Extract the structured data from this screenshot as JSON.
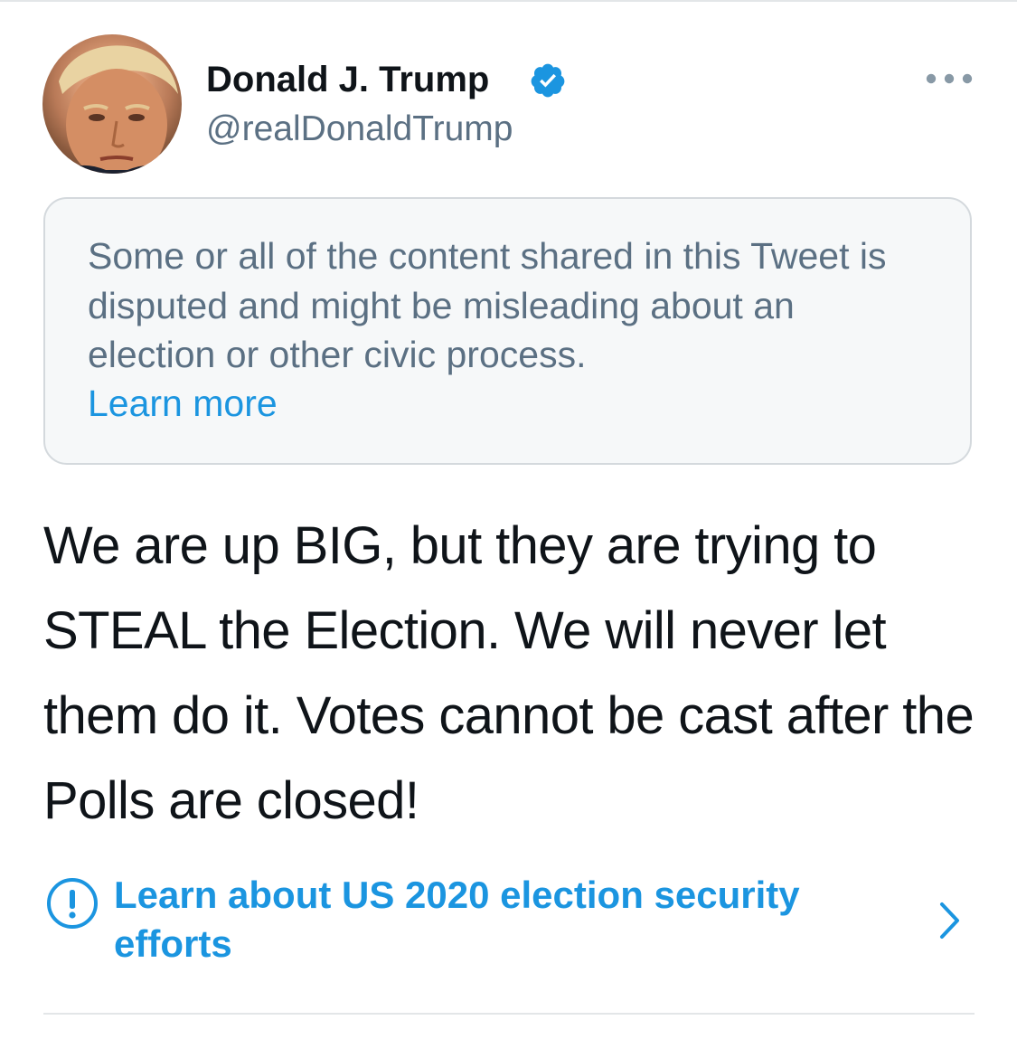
{
  "author": {
    "display_name": "Donald J. Trump",
    "handle": "@realDonaldTrump",
    "verified": true,
    "avatar_icon": "profile-photo"
  },
  "notice": {
    "text": "Some or all of the content shared in this Tweet is disputed and might be misleading about an election or other civic process.",
    "link_label": "Learn more"
  },
  "tweet": {
    "text": "We are up BIG, but they are trying to STEAL the Election. We will never let them do it. Votes cannot be cast after the Polls are closed!"
  },
  "election_prompt": {
    "label": "Learn about US 2020 election security efforts",
    "icon": "info-icon",
    "chevron": "chevron-right-icon"
  },
  "colors": {
    "accent": "#1b95e0",
    "secondary_text": "#5b7083",
    "primary_text": "#0f1419",
    "notice_background": "#f6f8f9",
    "divider": "#e3e6e8"
  }
}
